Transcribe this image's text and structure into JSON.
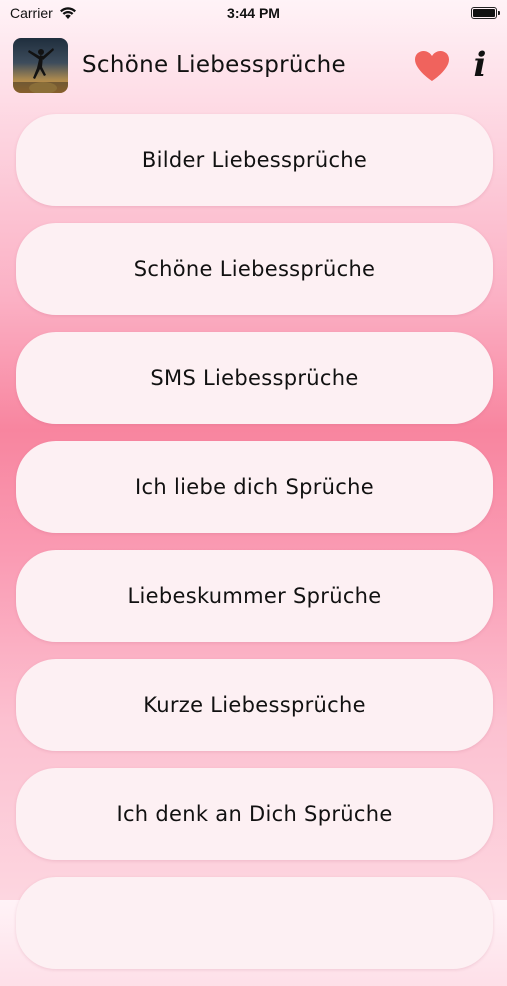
{
  "status_bar": {
    "carrier": "Carrier",
    "time": "3:44 PM",
    "wifi_icon": "wifi-icon",
    "battery_icon": "battery-icon"
  },
  "header": {
    "app_icon": "silhouette-sunset-icon",
    "title": "Schöne Liebessprüche",
    "favorites_icon": "heart-icon",
    "favorites_color": "#f0635d",
    "info_icon": "info-icon",
    "info_glyph": "i"
  },
  "menu": {
    "items": [
      {
        "label": "Bilder Liebessprüche"
      },
      {
        "label": "Schöne Liebessprüche"
      },
      {
        "label": "SMS Liebessprüche"
      },
      {
        "label": "Ich liebe dich Sprüche"
      },
      {
        "label": "Liebeskummer Sprüche"
      },
      {
        "label": "Kurze Liebessprüche"
      },
      {
        "label": "Ich denk an Dich Sprüche"
      },
      {
        "label": ""
      }
    ]
  },
  "colors": {
    "background_top": "#fff3f7",
    "background_mid": "#f8859f",
    "button_fill": "#fdf0f3",
    "text": "#111111"
  }
}
